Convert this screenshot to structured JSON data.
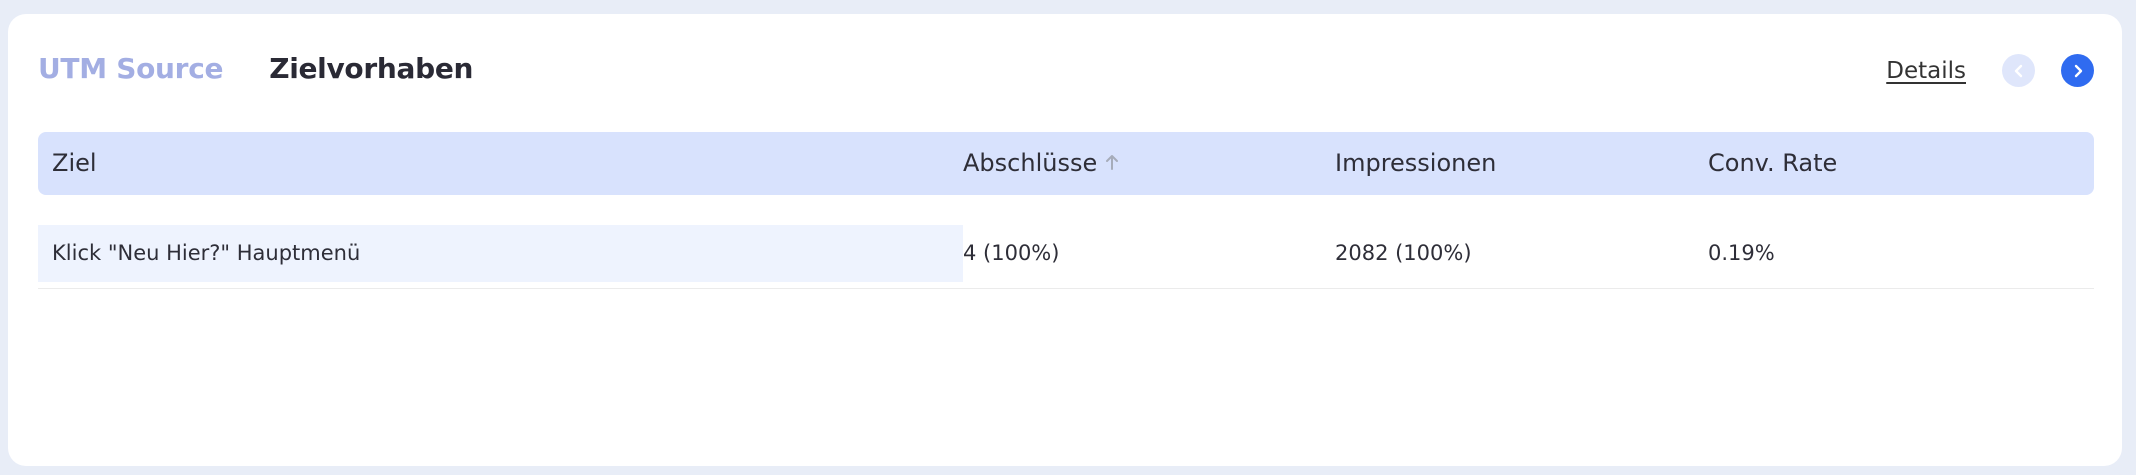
{
  "tabs": [
    {
      "label": "UTM Source",
      "active": false
    },
    {
      "label": "Zielvorhaben",
      "active": true
    }
  ],
  "header_actions": {
    "details_label": "Details"
  },
  "table": {
    "columns": [
      "Ziel",
      "Abschlüsse",
      "Impressionen",
      "Conv. Rate"
    ],
    "sorted_column": "Abschlüsse",
    "rows": [
      {
        "ziel": "Klick \"Neu Hier?\" Hauptmenü",
        "abschluesse": "4 (100%)",
        "impressionen": "2082 (100%)",
        "conv_rate": "0.19%"
      }
    ]
  },
  "colors": {
    "accent": "#2f6bf0",
    "header_bg": "#d8e2fd",
    "tab_inactive": "#a3aee3"
  },
  "icons": {
    "sort": "arrow-up-icon",
    "prev": "chevron-left-icon",
    "next": "chevron-right-icon"
  }
}
